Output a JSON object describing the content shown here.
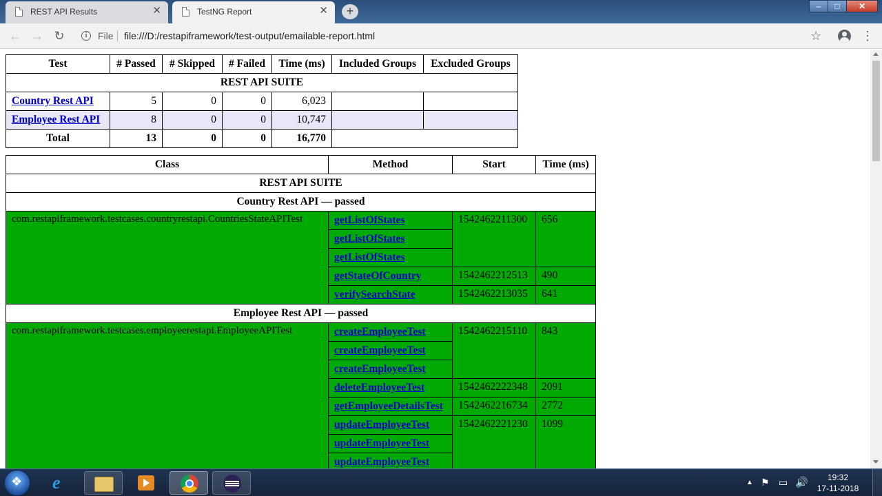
{
  "browser": {
    "tabs": [
      {
        "label": "REST API Results",
        "active": false
      },
      {
        "label": "TestNG Report",
        "active": true
      }
    ],
    "new_tab": "+",
    "address": {
      "scheme_label": "File",
      "url": "file:///D:/restapiframework/test-output/emailable-report.html"
    },
    "window_controls": {
      "minimize": "–",
      "maximize": "□",
      "close": "✕"
    }
  },
  "summary_table": {
    "headers": [
      "Test",
      "# Passed",
      "# Skipped",
      "# Failed",
      "Time (ms)",
      "Included Groups",
      "Excluded Groups"
    ],
    "suite_name": "REST API SUITE",
    "rows": [
      {
        "test": "Country Rest API",
        "passed": "5",
        "skipped": "0",
        "failed": "0",
        "time": "6,023",
        "included": "",
        "excluded": ""
      },
      {
        "test": "Employee Rest API",
        "passed": "8",
        "skipped": "0",
        "failed": "0",
        "time": "10,747",
        "included": "",
        "excluded": ""
      }
    ],
    "total": {
      "label": "Total",
      "passed": "13",
      "skipped": "0",
      "failed": "0",
      "time": "16,770"
    }
  },
  "methods_table": {
    "headers": [
      "Class",
      "Method",
      "Start",
      "Time (ms)"
    ],
    "suite_name": "REST API SUITE",
    "sections": [
      {
        "title": "Country Rest API — passed",
        "class_name": "com.restapiframework.testcases.countryrestapi.CountriesStateAPITest",
        "groups": [
          {
            "methods": [
              "getListOfStates",
              "getListOfStates",
              "getListOfStates"
            ],
            "start": "1542462211300",
            "time": "656"
          },
          {
            "methods": [
              "getStateOfCountry"
            ],
            "start": "1542462212513",
            "time": "490"
          },
          {
            "methods": [
              "verifySearchState"
            ],
            "start": "1542462213035",
            "time": "641"
          }
        ]
      },
      {
        "title": "Employee Rest API — passed",
        "class_name": "com.restapiframework.testcases.employeerestapi.EmployeeAPITest",
        "groups": [
          {
            "methods": [
              "createEmployeeTest",
              "createEmployeeTest",
              "createEmployeeTest"
            ],
            "start": "1542462215110",
            "time": "843"
          },
          {
            "methods": [
              "deleteEmployeeTest"
            ],
            "start": "1542462222348",
            "time": "2091"
          },
          {
            "methods": [
              "getEmployeeDetailsTest"
            ],
            "start": "1542462216734",
            "time": "2772"
          },
          {
            "methods": [
              "updateEmployeeTest",
              "updateEmployeeTest",
              "updateEmployeeTest"
            ],
            "start": "1542462221230",
            "time": "1099"
          }
        ]
      }
    ]
  },
  "taskbar": {
    "pinned": [
      "internet-explorer-icon",
      "file-explorer-icon",
      "media-player-icon",
      "chrome-icon",
      "eclipse-icon"
    ],
    "clock": {
      "time": "19:32",
      "date": "17-11-2018"
    }
  },
  "colors": {
    "pass_green": "#00aa00",
    "link": "#0000cc",
    "stripe": "#e7e7f8"
  }
}
